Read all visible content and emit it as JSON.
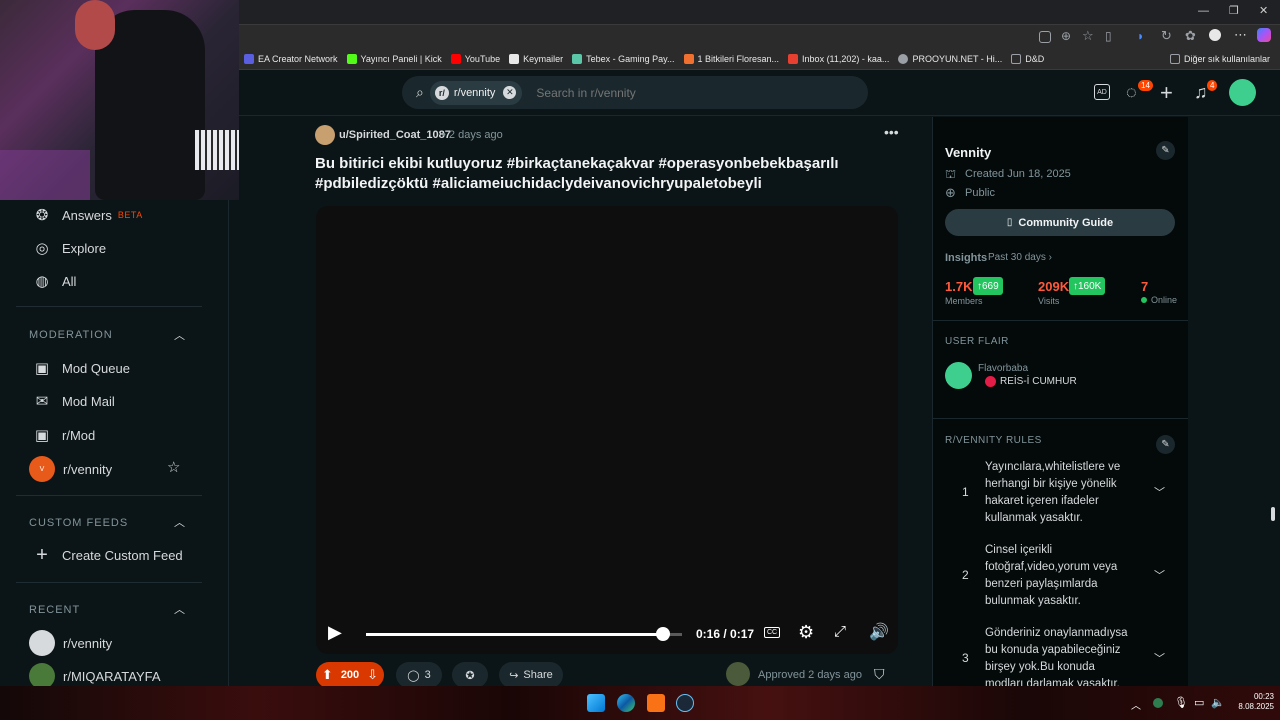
{
  "bookmarks": [
    {
      "label": "EA Creator Network",
      "color": "#5a5fe0"
    },
    {
      "label": "Yayıncı Paneli | Kick",
      "color": "#53fc18"
    },
    {
      "label": "YouTube",
      "color": "#ff0000"
    },
    {
      "label": "Keymailer",
      "color": "#e8e8e8"
    },
    {
      "label": "Tebex - Gaming Pay...",
      "color": "#5ac8a8"
    },
    {
      "label": "1 Bitkileri Floresan...",
      "color": "#f07030"
    },
    {
      "label": "Inbox (11,202) - kaa...",
      "color": "#e84030"
    },
    {
      "label": "PROOYUN.NET - Hi...",
      "color": "#9aa0a6"
    },
    {
      "label": "D&D",
      "color": "#9aa0a6"
    }
  ],
  "bookmarks_other": "Diğer sık kullanılanlar",
  "search": {
    "chip": "r/vennity",
    "placeholder": "Search in r/vennity"
  },
  "header": {
    "chat_badge": "14",
    "notif_badge": "4"
  },
  "leftnav": {
    "answers": "Answers",
    "beta": "BETA",
    "explore": "Explore",
    "all": "All",
    "moderation_title": "MODERATION",
    "mod_queue": "Mod Queue",
    "mod_mail": "Mod Mail",
    "r_mod": "r/Mod",
    "r_vennity": "r/vennity",
    "custom_feeds_title": "CUSTOM FEEDS",
    "create_custom_feed": "Create Custom Feed",
    "recent_title": "RECENT",
    "recent_1": "r/vennity",
    "recent_2": "r/MIQARATAYFA"
  },
  "post": {
    "author": "u/Spirited_Coat_1087",
    "time": "• 2 days ago",
    "title_line1": "Bu bitirici ekibi kutluyoruz #birkaçtanekaçakvar #operasyonbebekbaşarılı",
    "title_line2": "#pdbiledizçöktü #aliciameiuchidaclydeivanovichryupaletobeyli",
    "video_time": "0:16 / 0:17",
    "video_progress": 0.94,
    "cc": "CC",
    "upvotes": "200",
    "comments": "3",
    "share": "Share",
    "approved": "Approved 2 days ago"
  },
  "community": {
    "name": "Vennity",
    "created": "Created Jun 18, 2025",
    "visibility": "Public",
    "guide_button": "Community Guide",
    "insights_label": "Insights",
    "insights_period": "Past 30 days",
    "members_value": "1.7K",
    "members_delta": "669",
    "members_label": "Members",
    "visits_value": "209K",
    "visits_delta": "160K",
    "visits_label": "Visits",
    "online_value": "7",
    "online_label": "Online",
    "user_flair_title": "USER FLAIR",
    "flair_user": "Flavorbaba",
    "flair_text": "REİS-İ CUMHUR",
    "rules_title": "R/VENNITY RULES",
    "rules": [
      {
        "num": "1",
        "text": "Yayıncılara,whitelistlere ve herhangi bir kişiye yönelik hakaret içeren ifadeler kullanmak yasaktır."
      },
      {
        "num": "2",
        "text": "Cinsel içerikli fotoğraf,video,yorum veya benzeri paylaşımlarda bulunmak yasaktır."
      },
      {
        "num": "3",
        "text": "Gönderiniz onaylanmadıysa bu konuda yapabileceğiniz birşey yok.Bu konuda modları darlamak yasaktır."
      }
    ]
  },
  "taskbar": {
    "time": "00:23",
    "date": "8.08.2025"
  },
  "colors": {
    "accent_up": "#ff4500",
    "insight_green": "#22c55e",
    "bg": "#0b1416"
  }
}
